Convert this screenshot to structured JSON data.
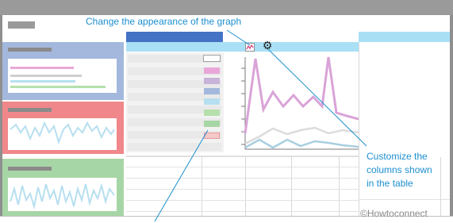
{
  "callouts": {
    "graph_appearance": "Change the appearance of the graph",
    "columns": [
      "Customize the",
      "columns shown",
      "in the table"
    ]
  },
  "watermark": "©Howtoconnect",
  "icons": {
    "graph_settings": "line-chart-icon",
    "column_settings": "gear-icon"
  },
  "colors": {
    "callout": "#1c8fcf",
    "tile_blue": "#a3b8dc",
    "tile_red": "#f0878a",
    "tile_green": "#a7d6a6",
    "header_blue": "#4472c4",
    "light_blue": "#a9e0f5",
    "series_pink": "#d9a3d8",
    "series_gray": "#dcdcdc",
    "series_blue": "#a9cfe0"
  }
}
